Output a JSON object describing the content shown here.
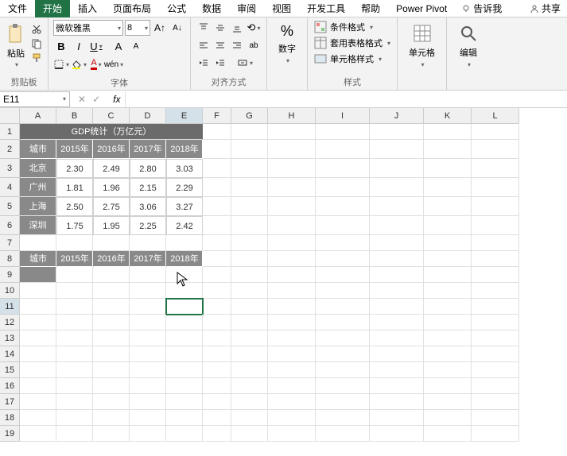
{
  "menu": {
    "file": "文件",
    "home": "开始",
    "insert": "插入",
    "layout": "页面布局",
    "formulas": "公式",
    "data": "数据",
    "review": "审阅",
    "view": "视图",
    "dev": "开发工具",
    "help": "帮助",
    "power": "Power Pivot",
    "tellme": "告诉我",
    "share": "共享"
  },
  "ribbon": {
    "clipboard_label": "剪贴板",
    "paste": "粘贴",
    "font_label": "字体",
    "font_name": "微软雅黑",
    "font_size": "8",
    "align_label": "对齐方式",
    "number_label": "数字",
    "cond_fmt": "条件格式",
    "table_fmt": "套用表格格式",
    "cell_style": "单元格样式",
    "styles_label": "样式",
    "cells_label": "单元格",
    "edit_label": "编辑"
  },
  "namebox": "E11",
  "formula": "",
  "cols": [
    "A",
    "B",
    "C",
    "D",
    "E",
    "F",
    "G",
    "H",
    "I",
    "J",
    "K",
    "L"
  ],
  "chart_data": {
    "type": "table",
    "title": "GDP统计（万亿元）",
    "columns": [
      "城市",
      "2015年",
      "2016年",
      "2017年",
      "2018年"
    ],
    "rows": [
      {
        "city": "北京",
        "v": [
          "2.30",
          "2.49",
          "2.80",
          "3.03"
        ]
      },
      {
        "city": "广州",
        "v": [
          "1.81",
          "1.96",
          "2.15",
          "2.29"
        ]
      },
      {
        "city": "上海",
        "v": [
          "2.50",
          "2.75",
          "3.06",
          "3.27"
        ]
      },
      {
        "city": "深圳",
        "v": [
          "1.75",
          "1.95",
          "2.25",
          "2.42"
        ]
      }
    ],
    "second_header": [
      "城市",
      "2015年",
      "2016年",
      "2017年",
      "2018年"
    ]
  }
}
